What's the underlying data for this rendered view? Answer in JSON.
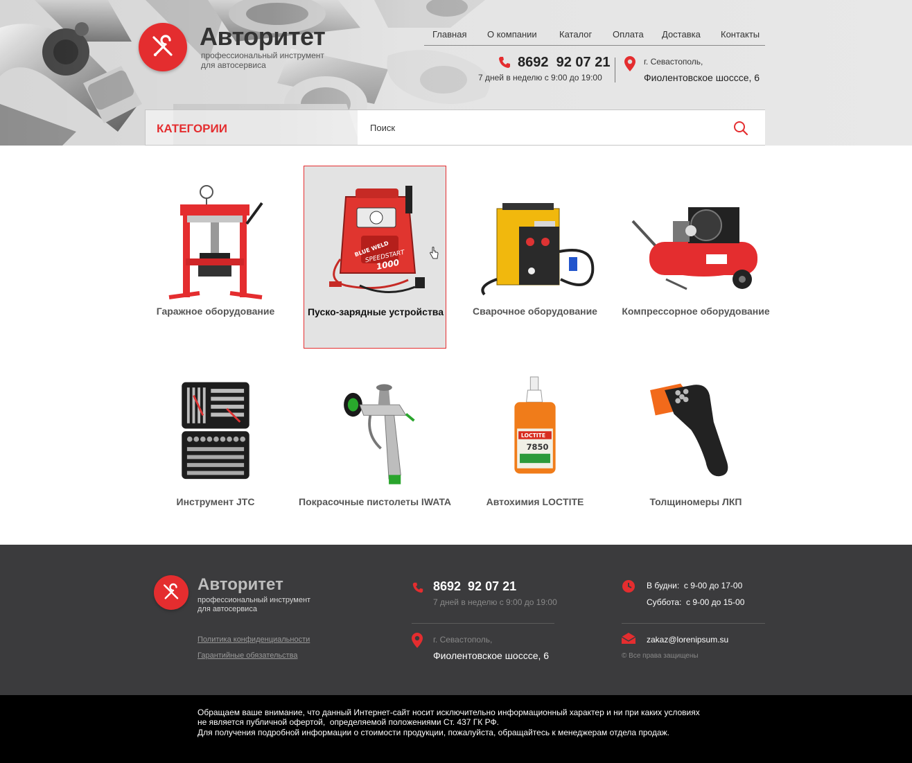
{
  "brand": {
    "name": "Авторитет",
    "tagline_line1": "профессиональный инструмент",
    "tagline_line2": "для автосервиса"
  },
  "nav": {
    "items": [
      "Главная",
      "О компании",
      "Каталог",
      "Оплата",
      "Доставка",
      "Контакты"
    ]
  },
  "contacts": {
    "phone": "8692  92 07 21",
    "hours": "7 дней в неделю с 9:00 до 19:00",
    "city": "г. Севастополь,",
    "street": "Фиолентовское шоссcе, 6"
  },
  "search": {
    "categories_label": "КАТЕГОРИИ",
    "placeholder": "Поиск"
  },
  "catalog": {
    "items": [
      {
        "label": "Гаражное оборудование",
        "icon": "hydraulic-press-image"
      },
      {
        "label": "Пуско-зарядные устройства",
        "icon": "jump-starter-image",
        "active": true
      },
      {
        "label": "Сварочное оборудование",
        "icon": "welder-image"
      },
      {
        "label": "Компрессорное оборудование",
        "icon": "compressor-image"
      },
      {
        "label": "Инструмент JTC",
        "icon": "tool-kit-image"
      },
      {
        "label": "Покрасочные пистолеты IWATA",
        "icon": "spray-gun-image"
      },
      {
        "label": "Автохимия LOCTITE",
        "icon": "loctite-bottle-image"
      },
      {
        "label": "Толщиномеры ЛКП",
        "icon": "thickness-gauge-image"
      }
    ]
  },
  "product_marks": {
    "jump_starter_brand": "BLUE WELD",
    "jump_starter_model": "SPEEDSTART",
    "jump_starter_num": "1000",
    "loctite_brand": "LOCTITE",
    "loctite_num": "7850"
  },
  "footer": {
    "privacy_link": "Политика конфиденциальности",
    "warranty_link": "Гарантийные обязательства",
    "weekdays": "В будни:  с 9-00 до 17-00",
    "saturday": "Суббота:  с 9-00 до 15-00",
    "email": "zakaz@lorenipsum.su",
    "copyright": "© Все права защищены"
  },
  "disclaimer": {
    "line1": "Обращаем ваше внимание, что данный Интернет-сайт носит исключительно информационный характер и ни при каких условиях",
    "line2": "не является публичной офертой,  определяемой положениями Ст. 437 ГК РФ.",
    "line3": "Для получения подробной информации о стоимости продукции, пожалуйста, обращайтесь к менеджерам отдела продаж."
  },
  "colors": {
    "accent": "#e42d2f",
    "footer_bg": "#3b3b3d",
    "disclaimer_bg": "#000000"
  }
}
